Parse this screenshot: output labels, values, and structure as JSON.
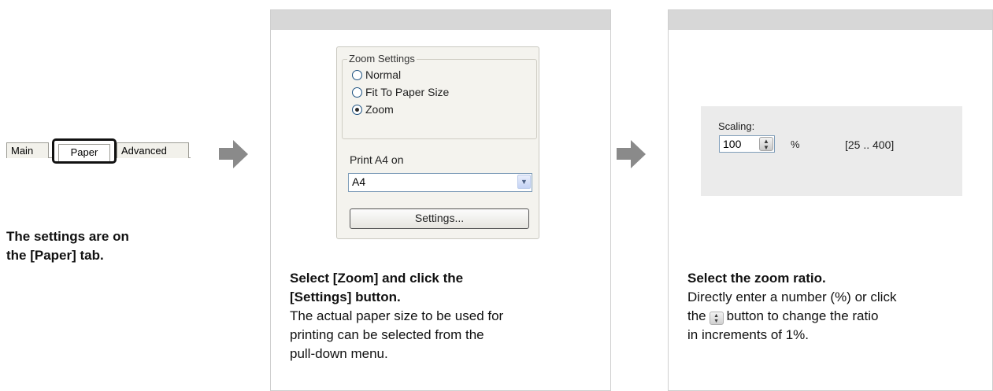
{
  "step1": {
    "tabs": [
      "Main",
      "Paper",
      "Advanced"
    ],
    "caption": [
      "The settings are on",
      "the [Paper] tab."
    ]
  },
  "step2": {
    "dialog": {
      "group_title": "Zoom Settings",
      "options": [
        "Normal",
        "Fit To Paper Size",
        "Zoom"
      ],
      "selected_option": "Zoom",
      "print_label": "Print A4 on",
      "paper_select_value": "A4",
      "settings_button": "Settings..."
    },
    "caption_bold": [
      "Select [Zoom] and click the",
      "[Settings] button."
    ],
    "caption_text": [
      "The actual paper size to be used for",
      "printing can be selected from the",
      "pull-down menu."
    ]
  },
  "step3": {
    "scaling": {
      "label": "Scaling:",
      "value": "100",
      "unit": "%",
      "range": "[25 .. 400]"
    },
    "caption_bold": "Select the zoom ratio.",
    "caption_line1": "Directly enter a number (%) or click",
    "caption_line2_before": "the",
    "caption_line2_after": "button to change the ratio",
    "caption_line3": "in increments of 1%."
  },
  "icons": {
    "arrow": "right-arrow-icon",
    "spinner": "spinner-updown-icon",
    "dropdown": "chevron-down-icon"
  },
  "colors": {
    "panel_header": "#d7d7d7",
    "arrow": "#8a8a8a",
    "scaling_box": "#ebebeb"
  }
}
